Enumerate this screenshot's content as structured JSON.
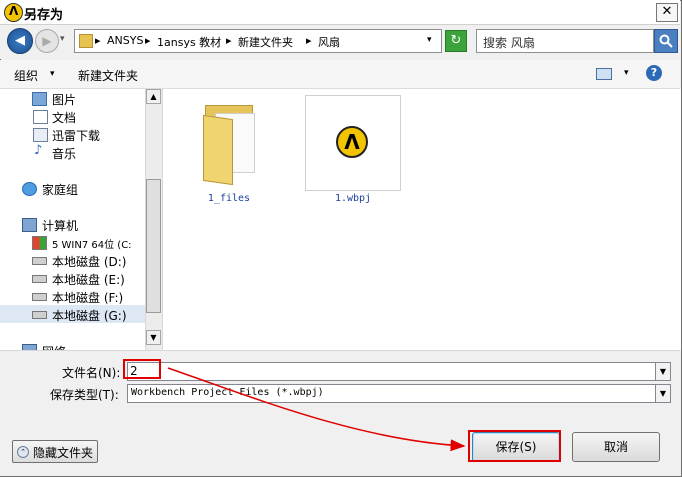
{
  "window": {
    "title": "另存为",
    "app_icon": "ansys-logo-icon",
    "close_label": "✕"
  },
  "navbar": {
    "back_label": "◀",
    "forward_label": "▶",
    "history_drop": "▾",
    "breadcrumbs": [
      "ANSYS",
      "1ansys 教材",
      "新建文件夹",
      "风扇"
    ],
    "crumb_separator": "▸",
    "address_drop": "▾",
    "refresh_label": "↻",
    "search_placeholder": "搜索 风扇",
    "search_icon": "search-icon"
  },
  "toolbar": {
    "organize_label": "组织",
    "organize_drop": "▾",
    "new_folder_label": "新建文件夹",
    "view_drop": "▾",
    "help_label": "?"
  },
  "nav_pane": {
    "items": [
      {
        "label": "图片",
        "icon": "pictures-icon"
      },
      {
        "label": "文档",
        "icon": "documents-icon"
      },
      {
        "label": "迅雷下载",
        "icon": "thunder-download-icon"
      },
      {
        "label": "音乐",
        "icon": "music-icon"
      },
      {
        "label": "家庭组",
        "icon": "homegroup-icon"
      },
      {
        "label": "计算机",
        "icon": "computer-icon"
      },
      {
        "label": "5 WIN7 64位 (C:",
        "icon": "windows-drive-icon"
      },
      {
        "label": "本地磁盘 (D:)",
        "icon": "drive-icon"
      },
      {
        "label": "本地磁盘 (E:)",
        "icon": "drive-icon"
      },
      {
        "label": "本地磁盘 (F:)",
        "icon": "drive-icon"
      },
      {
        "label": "本地磁盘 (G:)",
        "icon": "drive-icon",
        "selected": true
      },
      {
        "label": "网络",
        "icon": "network-icon"
      }
    ],
    "scroll_up": "▲",
    "scroll_down": "▼"
  },
  "files": [
    {
      "name": "1_files",
      "icon": "folder-icon"
    },
    {
      "name": "1.wbpj",
      "icon": "workbench-project-icon",
      "logo_letter": "Λ"
    }
  ],
  "form": {
    "filename_label": "文件名(N):",
    "filename_value": "2",
    "filetype_label": "保存类型(T):",
    "filetype_value": "Workbench Project Files (*.wbpj)",
    "drop": "▼"
  },
  "buttons": {
    "hide_folders": "隐藏文件夹",
    "hide_folders_icon": "⌃",
    "save": "保存(S)",
    "cancel": "取消"
  },
  "colors": {
    "annotation_red": "#e00000",
    "accent_blue": "#2c69b6",
    "ansys_yellow": "#f3c400"
  }
}
